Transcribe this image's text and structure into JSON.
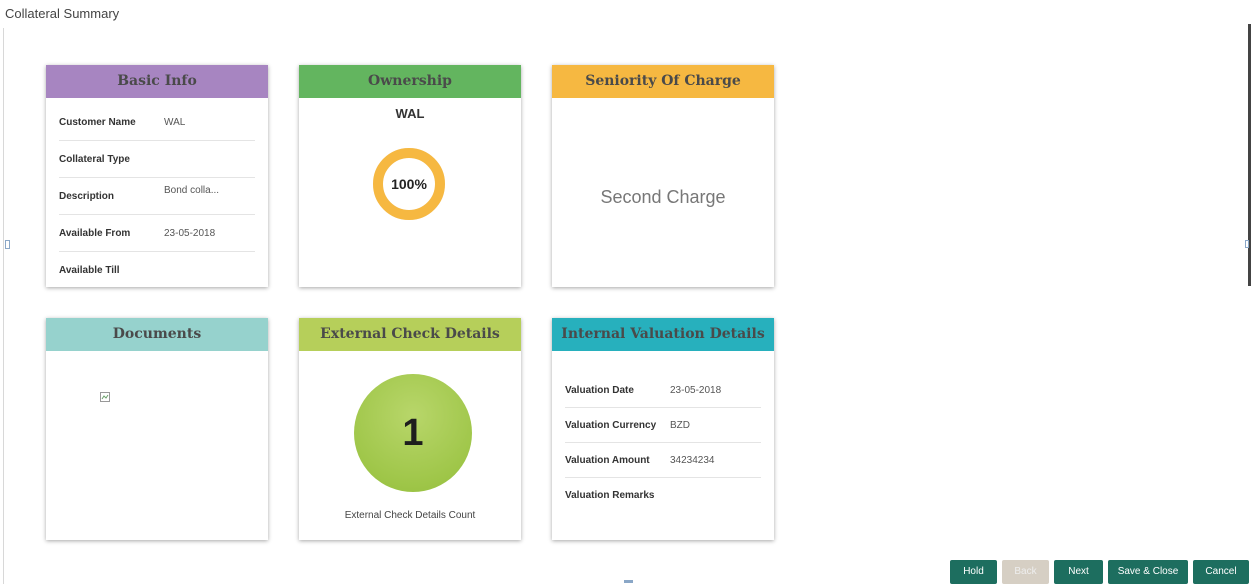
{
  "page": {
    "title": "Collateral Summary"
  },
  "basic_info": {
    "header": "Basic Info",
    "rows": [
      {
        "label": "Customer Name",
        "value": "WAL"
      },
      {
        "label": "Collateral Type",
        "value": ""
      },
      {
        "label": "Description",
        "value": "Bond colla..."
      },
      {
        "label": "Available From",
        "value": "23-05-2018"
      },
      {
        "label": "Available Till",
        "value": ""
      }
    ]
  },
  "ownership": {
    "header": "Ownership",
    "owner": "WAL",
    "percent_label": "100%",
    "percent": 100
  },
  "seniority": {
    "header": "Seniority Of Charge",
    "value": "Second Charge"
  },
  "documents": {
    "header": "Documents"
  },
  "external_check": {
    "header": "External Check Details",
    "count": "1",
    "count_label": "External Check Details Count"
  },
  "internal_valuation": {
    "header": "Internal Valuation Details",
    "rows": [
      {
        "label": "Valuation Date",
        "value": "23-05-2018"
      },
      {
        "label": "Valuation Currency",
        "value": "BZD"
      },
      {
        "label": "Valuation Amount",
        "value": "34234234"
      },
      {
        "label": "Valuation Remarks",
        "value": ""
      }
    ]
  },
  "footer": {
    "hold": "Hold",
    "back": "Back",
    "next": "Next",
    "save_close": "Save & Close",
    "cancel": "Cancel"
  },
  "colors": {
    "basic_info": "#a785c1",
    "ownership": "#63b55f",
    "seniority": "#f6b841",
    "documents": "#96d2cd",
    "external_check": "#b6cf5a",
    "internal_valuation": "#27b0bd",
    "button": "#1d6e5f"
  }
}
